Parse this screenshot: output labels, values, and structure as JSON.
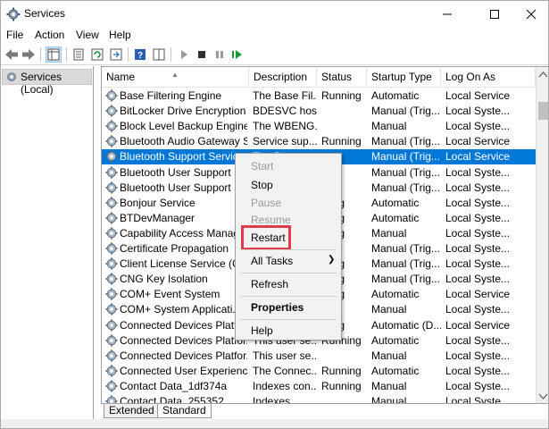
{
  "window": {
    "title": "Services"
  },
  "menu": [
    "File",
    "Action",
    "View",
    "Help"
  ],
  "tree": {
    "selected_label": "Services (Local)"
  },
  "columns": [
    "Name",
    "Description",
    "Status",
    "Startup Type",
    "Log On As"
  ],
  "rows": [
    [
      "Base Filtering Engine",
      "The Base Fil...",
      "Running",
      "Automatic",
      "Local Service"
    ],
    [
      "BitLocker Drive Encryption ...",
      "BDESVC hos...",
      "",
      "Manual (Trig...",
      "Local Syste..."
    ],
    [
      "Block Level Backup Engine ...",
      "The WBENG...",
      "",
      "Manual",
      "Local Syste..."
    ],
    [
      "Bluetooth Audio Gateway S...",
      "Service sup...",
      "Running",
      "Manual (Trig...",
      "Local Service"
    ],
    [
      "Bluetooth Support Service",
      "The Blu...",
      "",
      "Manual (Trig...",
      "Local Service"
    ],
    [
      "Bluetooth User Support S...",
      "",
      "",
      "Manual (Trig...",
      "Local Syste..."
    ],
    [
      "Bluetooth User Support S...",
      "",
      "",
      "Manual (Trig...",
      "Local Syste..."
    ],
    [
      "Bonjour Service",
      "",
      "...ing",
      "Automatic",
      "Local Syste..."
    ],
    [
      "BTDevManager",
      "",
      "...ing",
      "Automatic",
      "Local Syste..."
    ],
    [
      "Capability Access Manag...",
      "",
      "...ing",
      "Manual",
      "Local Syste..."
    ],
    [
      "Certificate Propagation",
      "",
      "",
      "Manual (Trig...",
      "Local Syste..."
    ],
    [
      "Client License Service (C...",
      "",
      "...ing",
      "Manual (Trig...",
      "Local Syste..."
    ],
    [
      "CNG Key Isolation",
      "",
      "...ing",
      "Manual (Trig...",
      "Local Syste..."
    ],
    [
      "COM+ Event System",
      "",
      "...ing",
      "Automatic",
      "Local Service"
    ],
    [
      "COM+ System Applicati...",
      "",
      "",
      "Manual",
      "Local Syste..."
    ],
    [
      "Connected Devices Platf...",
      "",
      "...ing",
      "Automatic (D...",
      "Local Service"
    ],
    [
      "Connected Devices Platfor...",
      "This user se...",
      "Running",
      "Automatic",
      "Local Syste..."
    ],
    [
      "Connected Devices Platfor...",
      "This user se...",
      "",
      "Manual",
      "Local Syste..."
    ],
    [
      "Connected User Experience...",
      "The Connec...",
      "Running",
      "Automatic",
      "Local Syste..."
    ],
    [
      "Contact Data_1df374a",
      "Indexes con...",
      "Running",
      "Manual",
      "Local Syste..."
    ],
    [
      "Contact Data_255352...",
      "Indexes...",
      "",
      "Manual",
      "Local Syste..."
    ]
  ],
  "selected_row_index": 4,
  "context_menu": {
    "start": "Start",
    "stop": "Stop",
    "pause": "Pause",
    "resume": "Resume",
    "restart": "Restart",
    "all_tasks": "All Tasks",
    "refresh": "Refresh",
    "properties": "Properties",
    "help": "Help"
  },
  "tabs": {
    "extended": "Extended",
    "standard": "Standard"
  },
  "colors": {
    "selection": "#0078d7",
    "highlight_box": "#e03c4c",
    "play": "#1a9a3a"
  },
  "icons": [
    "back-arrow-icon",
    "forward-arrow-icon",
    "show-tree-icon",
    "properties-icon",
    "refresh-icon",
    "export-icon",
    "help-icon",
    "split-view-icon",
    "play-icon",
    "stop-icon",
    "pause-icon",
    "resume-icon",
    "gear-icon"
  ]
}
